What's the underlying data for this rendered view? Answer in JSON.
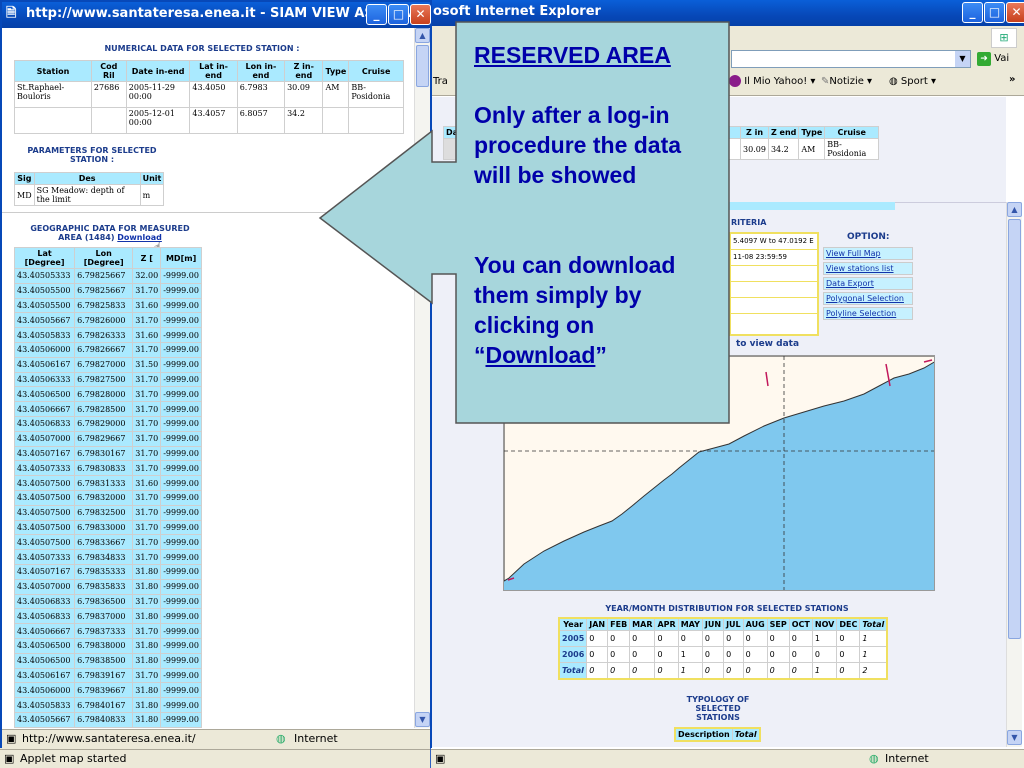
{
  "back_window": {
    "title": "osoft Internet Explorer",
    "address_go": "Vai",
    "links": [
      "Tra",
      "Il Mio Yahoo!",
      "Notizie",
      "Sport"
    ],
    "top_table": {
      "headers": [
        "Da",
        "Z in",
        "Z end",
        "Type",
        "Cruise"
      ],
      "row": [
        "",
        "30.09",
        "34.2",
        "AM",
        "BB-Posidonia"
      ]
    },
    "criteria_label": "RITERIA",
    "criteria_lines": [
      "5.4097 W to 47.0192 E",
      "11-08 23:59:59"
    ],
    "option_label": "OPTION:",
    "options": [
      "View Full Map",
      "View stations list",
      "Data Export",
      "Polygonal Selection",
      "Polyline Selection"
    ],
    "view_data_label": "to view data",
    "year_month_title": "YEAR/MONTH DISTRIBUTION FOR SELECTED STATIONS",
    "year_month_headers": [
      "Year",
      "JAN",
      "FEB",
      "MAR",
      "APR",
      "MAY",
      "JUN",
      "JUL",
      "AUG",
      "SEP",
      "OCT",
      "NOV",
      "DEC",
      "Total"
    ],
    "year_month_rows": [
      [
        "2005",
        "0",
        "0",
        "0",
        "0",
        "0",
        "0",
        "0",
        "0",
        "0",
        "0",
        "1",
        "0",
        "1"
      ],
      [
        "2006",
        "0",
        "0",
        "0",
        "0",
        "1",
        "0",
        "0",
        "0",
        "0",
        "0",
        "0",
        "0",
        "1"
      ],
      [
        "Total",
        "0",
        "0",
        "0",
        "0",
        "1",
        "0",
        "0",
        "0",
        "0",
        "0",
        "1",
        "0",
        "2"
      ]
    ],
    "typology_title": "TYPOLOGY OF SELECTED STATIONS",
    "typology_headers": [
      "Description",
      "Total"
    ],
    "status_text": "Applet map started",
    "status_zone": "Internet"
  },
  "front_window": {
    "title": "http://www.santateresa.enea.it - SIAM VIEW ASCII DATA - Mi...",
    "numerical_title": "NUMERICAL DATA FOR SELECTED STATION :",
    "numerical_headers": [
      "Station",
      "Cod Ril",
      "Date in-end",
      "Lat in-end",
      "Lon in-end",
      "Z in-end",
      "Type",
      "Cruise"
    ],
    "numerical_rows": [
      [
        "St.Raphael-Bouloris",
        "27686",
        "2005-11-29 00:00",
        "43.4050",
        "6.7983",
        "30.09",
        "AM",
        "BB-Posidonia"
      ],
      [
        "",
        "",
        "2005-12-01 00:00",
        "43.4057",
        "6.8057",
        "34.2",
        "",
        ""
      ]
    ],
    "params_title": "PARAMETERS FOR SELECTED STATION :",
    "params_headers": [
      "Sig",
      "Des",
      "Unit"
    ],
    "params_row": [
      "MD",
      "SG Meadow: depth of the limit",
      "m"
    ],
    "geo_title": "GEOGRAPHIC DATA FOR MEASURED AREA (1484)",
    "geo_download": "Download",
    "geo_headers": [
      "Lat [Degree]",
      "Lon [Degree]",
      "Z [",
      "MD[m]"
    ],
    "geo_rows": [
      [
        "43.40505333",
        "6.79825667",
        "32.00",
        "-9999.00"
      ],
      [
        "43.40505500",
        "6.79825667",
        "31.70",
        "-9999.00"
      ],
      [
        "43.40505500",
        "6.79825833",
        "31.60",
        "-9999.00"
      ],
      [
        "43.40505667",
        "6.79826000",
        "31.70",
        "-9999.00"
      ],
      [
        "43.40505833",
        "6.79826333",
        "31.60",
        "-9999.00"
      ],
      [
        "43.40506000",
        "6.79826667",
        "31.70",
        "-9999.00"
      ],
      [
        "43.40506167",
        "6.79827000",
        "31.50",
        "-9999.00"
      ],
      [
        "43.40506333",
        "6.79827500",
        "31.70",
        "-9999.00"
      ],
      [
        "43.40506500",
        "6.79828000",
        "31.70",
        "-9999.00"
      ],
      [
        "43.40506667",
        "6.79828500",
        "31.70",
        "-9999.00"
      ],
      [
        "43.40506833",
        "6.79829000",
        "31.70",
        "-9999.00"
      ],
      [
        "43.40507000",
        "6.79829667",
        "31.70",
        "-9999.00"
      ],
      [
        "43.40507167",
        "6.79830167",
        "31.70",
        "-9999.00"
      ],
      [
        "43.40507333",
        "6.79830833",
        "31.70",
        "-9999.00"
      ],
      [
        "43.40507500",
        "6.79831333",
        "31.60",
        "-9999.00"
      ],
      [
        "43.40507500",
        "6.79832000",
        "31.70",
        "-9999.00"
      ],
      [
        "43.40507500",
        "6.79832500",
        "31.70",
        "-9999.00"
      ],
      [
        "43.40507500",
        "6.79833000",
        "31.70",
        "-9999.00"
      ],
      [
        "43.40507500",
        "6.79833667",
        "31.70",
        "-9999.00"
      ],
      [
        "43.40507333",
        "6.79834833",
        "31.70",
        "-9999.00"
      ],
      [
        "43.40507167",
        "6.79835333",
        "31.80",
        "-9999.00"
      ],
      [
        "43.40507000",
        "6.79835833",
        "31.80",
        "-9999.00"
      ],
      [
        "43.40506833",
        "6.79836500",
        "31.70",
        "-9999.00"
      ],
      [
        "43.40506833",
        "6.79837000",
        "31.80",
        "-9999.00"
      ],
      [
        "43.40506667",
        "6.79837333",
        "31.70",
        "-9999.00"
      ],
      [
        "43.40506500",
        "6.79838000",
        "31.80",
        "-9999.00"
      ],
      [
        "43.40506500",
        "6.79838500",
        "31.80",
        "-9999.00"
      ],
      [
        "43.40506167",
        "6.79839167",
        "31.70",
        "-9999.00"
      ],
      [
        "43.40506000",
        "6.79839667",
        "31.80",
        "-9999.00"
      ],
      [
        "43.40505833",
        "6.79840167",
        "31.80",
        "-9999.00"
      ],
      [
        "43.40505667",
        "6.79840833",
        "31.80",
        "-9999.00"
      ]
    ],
    "status_url": "http://www.santateresa.enea.it/",
    "status_zone": "Internet"
  },
  "callout": {
    "heading": "RESERVED AREA",
    "para1": "Only after a log-in procedure the data will be showed",
    "para2_lead": "You can download them simply by clicking on",
    "para2_open_quote": "“",
    "para2_link": "Download",
    "para2_close_quote": "”"
  },
  "colors": {
    "callout_bg": "#a7d6dc",
    "heading": "#0000aa",
    "table_header": "#aaeaff",
    "map_water": "#7fc8ee",
    "title_bar": "#0a5fd8"
  }
}
